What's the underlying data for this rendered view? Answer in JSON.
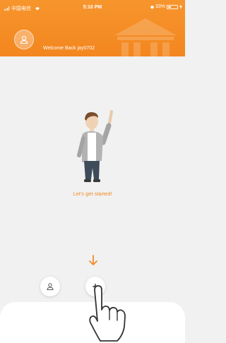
{
  "status_bar": {
    "carrier": "中国电信",
    "time": "5:10 PM",
    "battery": "33%"
  },
  "header": {
    "welcome_text": "Welcome Back jay0702"
  },
  "main": {
    "cta_text": "Let's get started!"
  },
  "colors": {
    "accent": "#f3861f",
    "background": "#f1f1f1",
    "cta_text": "#f08c28"
  },
  "icons": {
    "avatar": "user-avatar-icon",
    "down": "arrow-down-icon",
    "fab_user": "user-icon",
    "fab_compass": "compass-icon",
    "hand": "pointing-hand-icon"
  }
}
